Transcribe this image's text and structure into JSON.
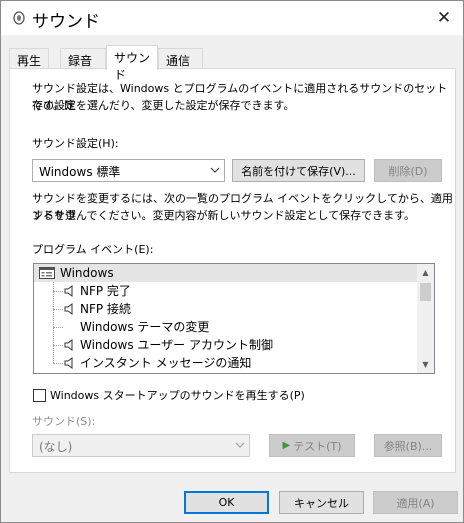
{
  "window": {
    "title": "サウンド"
  },
  "tabs": [
    {
      "label": "再生"
    },
    {
      "label": "録音"
    },
    {
      "label": "サウンド"
    },
    {
      "label": "通信"
    }
  ],
  "description": {
    "line1": "サウンド設定は、Windows とプログラムのイベントに適用されるサウンドのセットです。既",
    "line2": "存の設定を選んだり、変更した設定が保存できます。"
  },
  "scheme": {
    "label": "サウンド設定(H):",
    "value": "Windows 標準",
    "save_button": "名前を付けて保存(V)...",
    "delete_button": "削除(D)"
  },
  "instructions": {
    "line1": "サウンドを変更するには、次の一覧のプログラム イベントをクリックしてから、適用するサウ",
    "line2": "ンドを選んでください。変更内容が新しいサウンド設定として保存できます。"
  },
  "events": {
    "label": "プログラム イベント(E):",
    "root": "Windows",
    "items": [
      {
        "label": "NFP 完了",
        "has_sound": true
      },
      {
        "label": "NFP 接続",
        "has_sound": true
      },
      {
        "label": "Windows テーマの変更",
        "has_sound": false
      },
      {
        "label": "Windows ユーザー アカウント制御",
        "has_sound": true
      },
      {
        "label": "インスタント メッセージの通知",
        "has_sound": true
      }
    ]
  },
  "startup": {
    "label": "Windows スタートアップのサウンドを再生する(P)",
    "checked": false
  },
  "sound": {
    "label": "サウンド(S):",
    "value": "(なし)",
    "test_button": "テスト(T)",
    "browse_button": "参照(B)..."
  },
  "footer": {
    "ok": "OK",
    "cancel": "キャンセル",
    "apply": "適用(A)"
  }
}
